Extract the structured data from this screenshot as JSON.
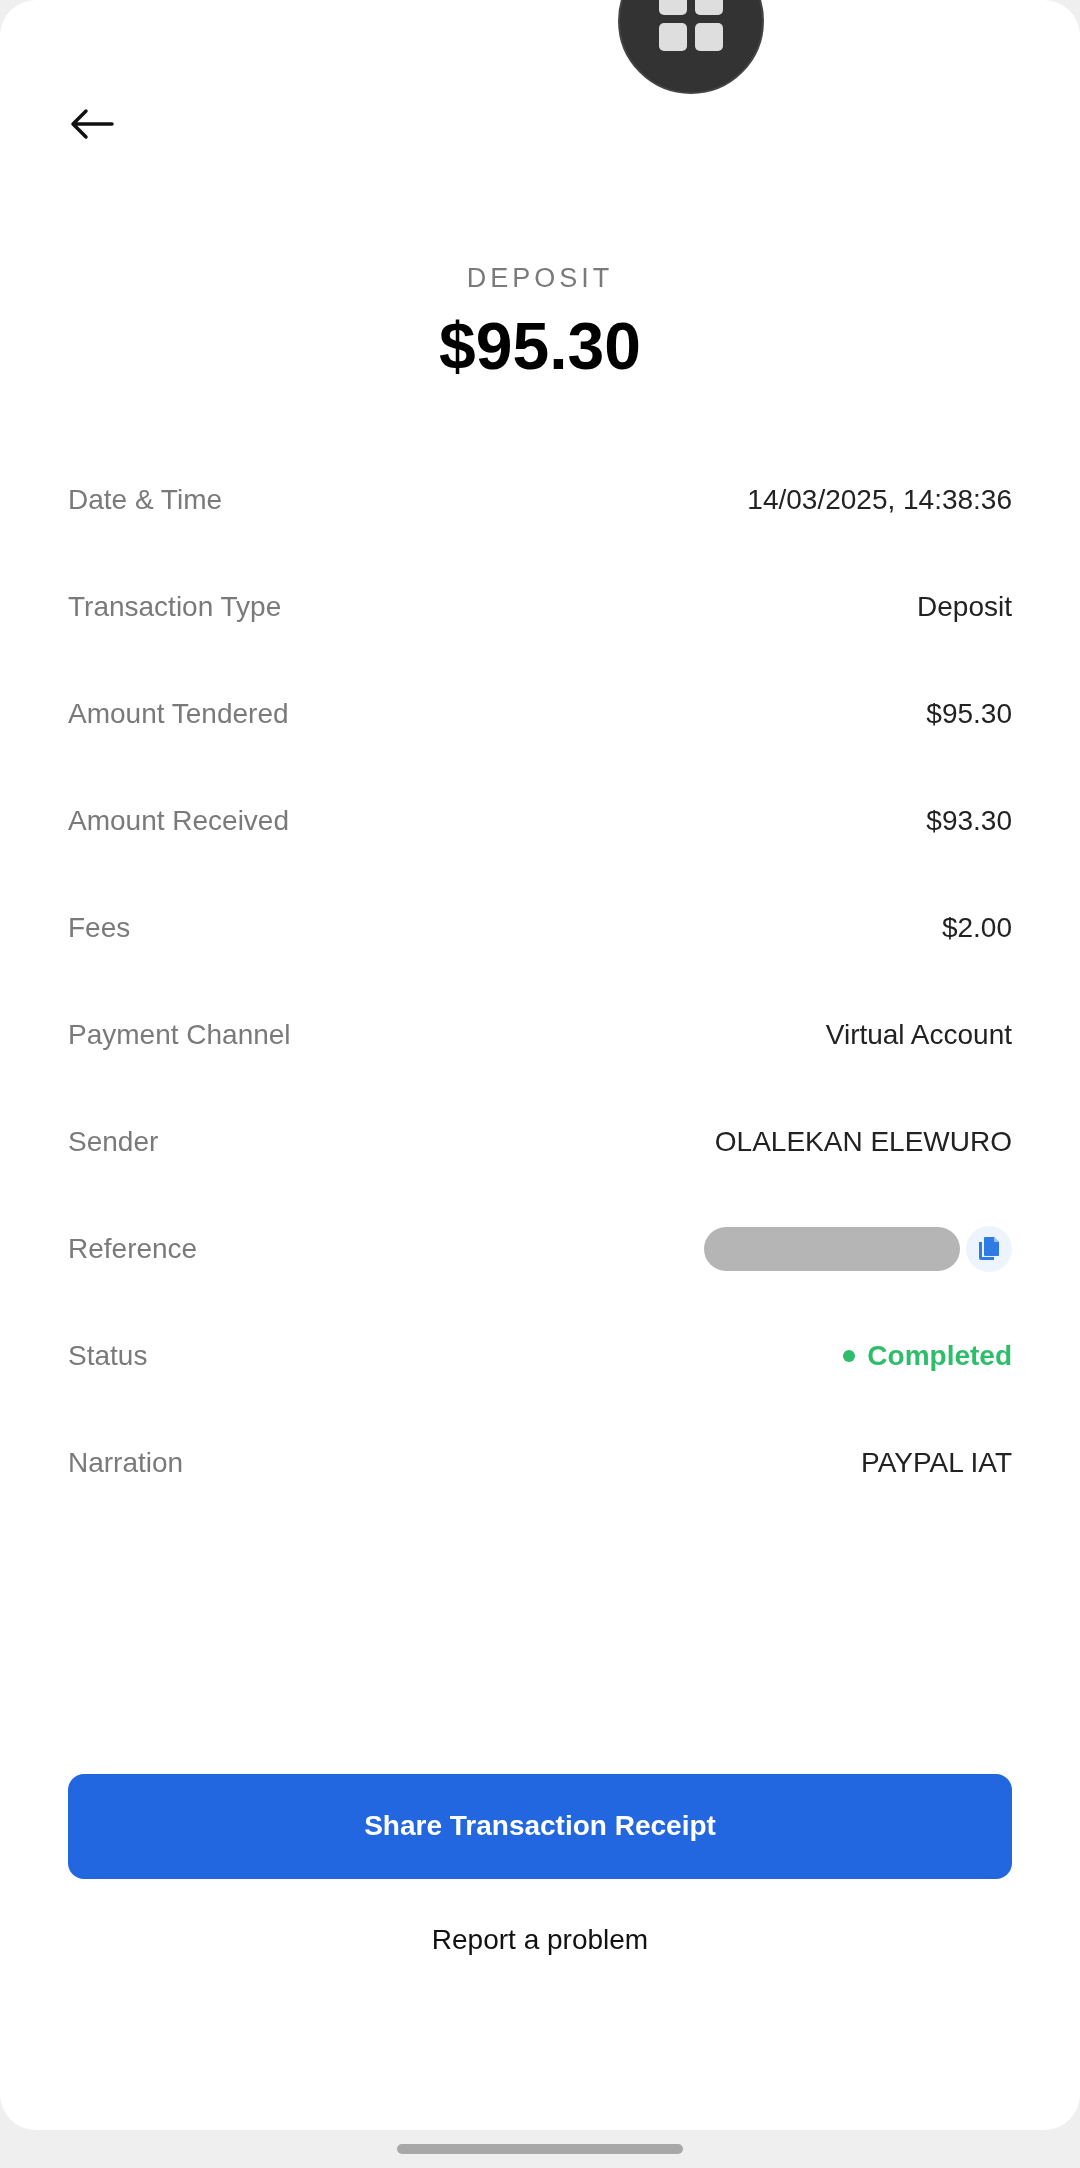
{
  "header": {
    "type_label": "DEPOSIT",
    "amount": "$95.30"
  },
  "rows": [
    {
      "kind": "text",
      "label": "Date & Time",
      "value": "14/03/2025, 14:38:36"
    },
    {
      "kind": "text",
      "label": "Transaction Type",
      "value": "Deposit"
    },
    {
      "kind": "text",
      "label": "Amount Tendered",
      "value": "$95.30"
    },
    {
      "kind": "text",
      "label": "Amount Received",
      "value": "$93.30"
    },
    {
      "kind": "text",
      "label": "Fees",
      "value": "$2.00"
    },
    {
      "kind": "text",
      "label": "Payment Channel",
      "value": "Virtual Account"
    },
    {
      "kind": "text",
      "label": "Sender",
      "value": "OLALEKAN ELEWURO"
    },
    {
      "kind": "redacted",
      "label": "Reference"
    },
    {
      "kind": "status",
      "label": "Status",
      "value": "Completed",
      "color": "#2ebd6b"
    },
    {
      "kind": "text",
      "label": "Narration",
      "value": "PAYPAL IAT"
    }
  ],
  "primary_button": "Share Transaction Receipt",
  "secondary_link": "Report a problem"
}
